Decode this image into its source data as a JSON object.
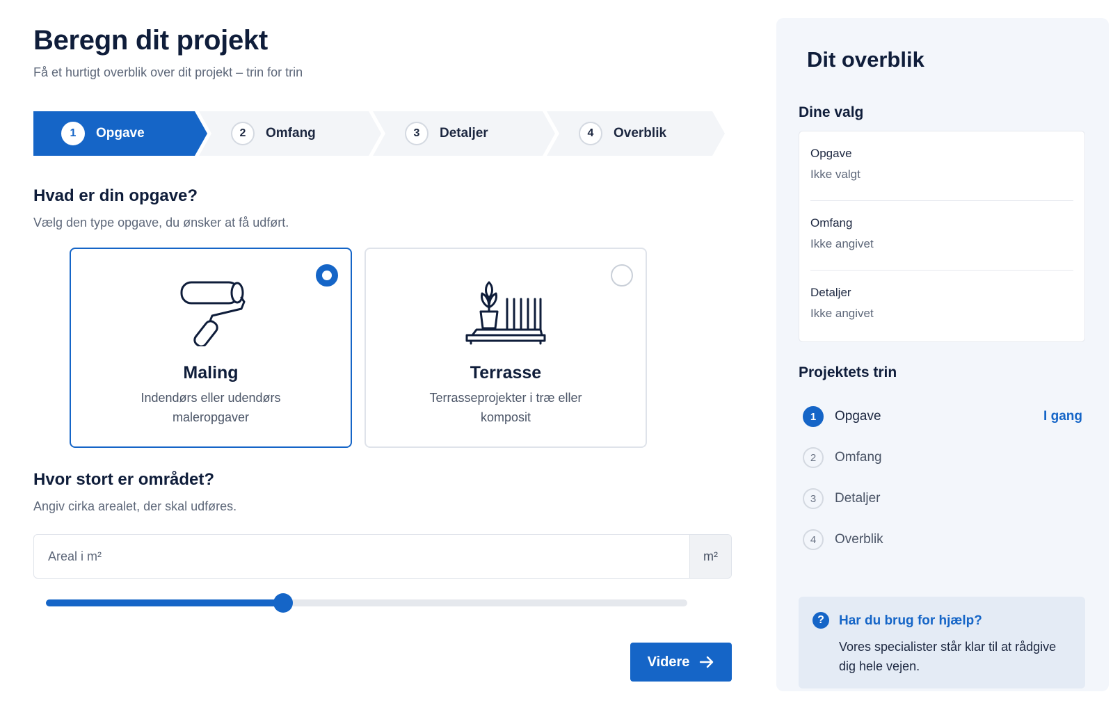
{
  "header": {
    "title": "Beregn dit projekt",
    "subtitle": "Få et hurtigt overblik over dit projekt – trin for trin"
  },
  "stepper": {
    "steps": [
      {
        "num": "1",
        "label": "Opgave",
        "active": true
      },
      {
        "num": "2",
        "label": "Omfang",
        "active": false
      },
      {
        "num": "3",
        "label": "Detaljer",
        "active": false
      },
      {
        "num": "4",
        "label": "Overblik",
        "active": false
      }
    ]
  },
  "task_section": {
    "heading": "Hvad er din opgave?",
    "hint": "Vælg den type opgave, du ønsker at få udført.",
    "options": [
      {
        "name": "Maling",
        "desc": "Indendørs eller udendørs maleropgaver",
        "selected": true,
        "icon": "paint-roller-icon"
      },
      {
        "name": "Terrasse",
        "desc": "Terrasseprojekter i træ eller komposit",
        "selected": false,
        "icon": "terrace-plant-icon"
      }
    ]
  },
  "area_section": {
    "heading": "Hvor stort er området?",
    "hint": "Angiv cirka arealet, der skal udføres.",
    "input_value": "",
    "input_placeholder": "Areal i m²",
    "unit": "m²",
    "slider_fraction": 0.37
  },
  "next_button": {
    "label": "Videre",
    "icon": "arrow-right-icon"
  },
  "sidebar": {
    "title": "Dit overblik",
    "choices_heading": "Dine valg",
    "choices": [
      {
        "key": "Opgave",
        "value": "Ikke valgt"
      },
      {
        "key": "Omfang",
        "value": "Ikke angivet"
      },
      {
        "key": "Detaljer",
        "value": "Ikke angivet"
      }
    ],
    "steps_heading": "Projektets trin",
    "steps": [
      {
        "num": "1",
        "label": "Opgave",
        "status": "I gang",
        "active": true
      },
      {
        "num": "2",
        "label": "Omfang",
        "status": "",
        "active": false
      },
      {
        "num": "3",
        "label": "Detaljer",
        "status": "",
        "active": false
      },
      {
        "num": "4",
        "label": "Overblik",
        "status": "",
        "active": false
      }
    ],
    "help": {
      "icon": "question-icon",
      "title": "Har du brug for hjælp?",
      "text": "Vores specialister står klar til at rådgive dig hele vejen."
    }
  },
  "colors": {
    "accent": "#1565c7",
    "text": "#0f1d3a",
    "muted": "#5d6779",
    "sidebar_bg": "#f3f6fb",
    "step_inactive_bg": "#f3f5f8"
  }
}
